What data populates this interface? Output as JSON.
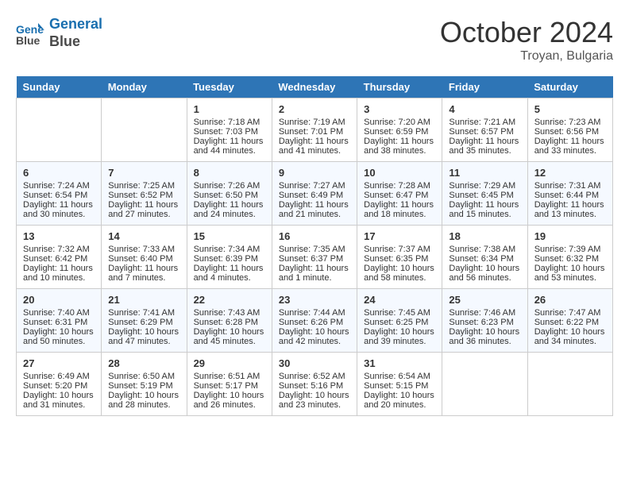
{
  "header": {
    "logo_line1": "General",
    "logo_line2": "Blue",
    "month": "October 2024",
    "location": "Troyan, Bulgaria"
  },
  "days_of_week": [
    "Sunday",
    "Monday",
    "Tuesday",
    "Wednesday",
    "Thursday",
    "Friday",
    "Saturday"
  ],
  "weeks": [
    [
      {
        "day": "",
        "sunrise": "",
        "sunset": "",
        "daylight": ""
      },
      {
        "day": "",
        "sunrise": "",
        "sunset": "",
        "daylight": ""
      },
      {
        "day": "1",
        "sunrise": "Sunrise: 7:18 AM",
        "sunset": "Sunset: 7:03 PM",
        "daylight": "Daylight: 11 hours and 44 minutes."
      },
      {
        "day": "2",
        "sunrise": "Sunrise: 7:19 AM",
        "sunset": "Sunset: 7:01 PM",
        "daylight": "Daylight: 11 hours and 41 minutes."
      },
      {
        "day": "3",
        "sunrise": "Sunrise: 7:20 AM",
        "sunset": "Sunset: 6:59 PM",
        "daylight": "Daylight: 11 hours and 38 minutes."
      },
      {
        "day": "4",
        "sunrise": "Sunrise: 7:21 AM",
        "sunset": "Sunset: 6:57 PM",
        "daylight": "Daylight: 11 hours and 35 minutes."
      },
      {
        "day": "5",
        "sunrise": "Sunrise: 7:23 AM",
        "sunset": "Sunset: 6:56 PM",
        "daylight": "Daylight: 11 hours and 33 minutes."
      }
    ],
    [
      {
        "day": "6",
        "sunrise": "Sunrise: 7:24 AM",
        "sunset": "Sunset: 6:54 PM",
        "daylight": "Daylight: 11 hours and 30 minutes."
      },
      {
        "day": "7",
        "sunrise": "Sunrise: 7:25 AM",
        "sunset": "Sunset: 6:52 PM",
        "daylight": "Daylight: 11 hours and 27 minutes."
      },
      {
        "day": "8",
        "sunrise": "Sunrise: 7:26 AM",
        "sunset": "Sunset: 6:50 PM",
        "daylight": "Daylight: 11 hours and 24 minutes."
      },
      {
        "day": "9",
        "sunrise": "Sunrise: 7:27 AM",
        "sunset": "Sunset: 6:49 PM",
        "daylight": "Daylight: 11 hours and 21 minutes."
      },
      {
        "day": "10",
        "sunrise": "Sunrise: 7:28 AM",
        "sunset": "Sunset: 6:47 PM",
        "daylight": "Daylight: 11 hours and 18 minutes."
      },
      {
        "day": "11",
        "sunrise": "Sunrise: 7:29 AM",
        "sunset": "Sunset: 6:45 PM",
        "daylight": "Daylight: 11 hours and 15 minutes."
      },
      {
        "day": "12",
        "sunrise": "Sunrise: 7:31 AM",
        "sunset": "Sunset: 6:44 PM",
        "daylight": "Daylight: 11 hours and 13 minutes."
      }
    ],
    [
      {
        "day": "13",
        "sunrise": "Sunrise: 7:32 AM",
        "sunset": "Sunset: 6:42 PM",
        "daylight": "Daylight: 11 hours and 10 minutes."
      },
      {
        "day": "14",
        "sunrise": "Sunrise: 7:33 AM",
        "sunset": "Sunset: 6:40 PM",
        "daylight": "Daylight: 11 hours and 7 minutes."
      },
      {
        "day": "15",
        "sunrise": "Sunrise: 7:34 AM",
        "sunset": "Sunset: 6:39 PM",
        "daylight": "Daylight: 11 hours and 4 minutes."
      },
      {
        "day": "16",
        "sunrise": "Sunrise: 7:35 AM",
        "sunset": "Sunset: 6:37 PM",
        "daylight": "Daylight: 11 hours and 1 minute."
      },
      {
        "day": "17",
        "sunrise": "Sunrise: 7:37 AM",
        "sunset": "Sunset: 6:35 PM",
        "daylight": "Daylight: 10 hours and 58 minutes."
      },
      {
        "day": "18",
        "sunrise": "Sunrise: 7:38 AM",
        "sunset": "Sunset: 6:34 PM",
        "daylight": "Daylight: 10 hours and 56 minutes."
      },
      {
        "day": "19",
        "sunrise": "Sunrise: 7:39 AM",
        "sunset": "Sunset: 6:32 PM",
        "daylight": "Daylight: 10 hours and 53 minutes."
      }
    ],
    [
      {
        "day": "20",
        "sunrise": "Sunrise: 7:40 AM",
        "sunset": "Sunset: 6:31 PM",
        "daylight": "Daylight: 10 hours and 50 minutes."
      },
      {
        "day": "21",
        "sunrise": "Sunrise: 7:41 AM",
        "sunset": "Sunset: 6:29 PM",
        "daylight": "Daylight: 10 hours and 47 minutes."
      },
      {
        "day": "22",
        "sunrise": "Sunrise: 7:43 AM",
        "sunset": "Sunset: 6:28 PM",
        "daylight": "Daylight: 10 hours and 45 minutes."
      },
      {
        "day": "23",
        "sunrise": "Sunrise: 7:44 AM",
        "sunset": "Sunset: 6:26 PM",
        "daylight": "Daylight: 10 hours and 42 minutes."
      },
      {
        "day": "24",
        "sunrise": "Sunrise: 7:45 AM",
        "sunset": "Sunset: 6:25 PM",
        "daylight": "Daylight: 10 hours and 39 minutes."
      },
      {
        "day": "25",
        "sunrise": "Sunrise: 7:46 AM",
        "sunset": "Sunset: 6:23 PM",
        "daylight": "Daylight: 10 hours and 36 minutes."
      },
      {
        "day": "26",
        "sunrise": "Sunrise: 7:47 AM",
        "sunset": "Sunset: 6:22 PM",
        "daylight": "Daylight: 10 hours and 34 minutes."
      }
    ],
    [
      {
        "day": "27",
        "sunrise": "Sunrise: 6:49 AM",
        "sunset": "Sunset: 5:20 PM",
        "daylight": "Daylight: 10 hours and 31 minutes."
      },
      {
        "day": "28",
        "sunrise": "Sunrise: 6:50 AM",
        "sunset": "Sunset: 5:19 PM",
        "daylight": "Daylight: 10 hours and 28 minutes."
      },
      {
        "day": "29",
        "sunrise": "Sunrise: 6:51 AM",
        "sunset": "Sunset: 5:17 PM",
        "daylight": "Daylight: 10 hours and 26 minutes."
      },
      {
        "day": "30",
        "sunrise": "Sunrise: 6:52 AM",
        "sunset": "Sunset: 5:16 PM",
        "daylight": "Daylight: 10 hours and 23 minutes."
      },
      {
        "day": "31",
        "sunrise": "Sunrise: 6:54 AM",
        "sunset": "Sunset: 5:15 PM",
        "daylight": "Daylight: 10 hours and 20 minutes."
      },
      {
        "day": "",
        "sunrise": "",
        "sunset": "",
        "daylight": ""
      },
      {
        "day": "",
        "sunrise": "",
        "sunset": "",
        "daylight": ""
      }
    ]
  ]
}
